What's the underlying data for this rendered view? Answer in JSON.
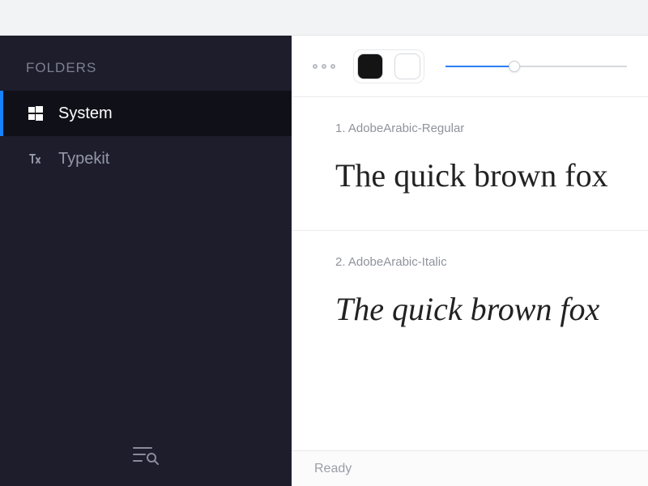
{
  "sidebar": {
    "header": "FOLDERS",
    "items": [
      {
        "label": "System",
        "icon": "windows-icon",
        "active": true
      },
      {
        "label": "Typekit",
        "icon": "typekit-icon",
        "active": false
      }
    ]
  },
  "toolbar": {
    "swatch_black": "#141414",
    "swatch_white": "#ffffff",
    "slider_percent": 38
  },
  "fonts": [
    {
      "index": "1.",
      "name": "AdobeArabic-Regular",
      "sample": "The quick brown fox",
      "style": "regular"
    },
    {
      "index": "2.",
      "name": "AdobeArabic-Italic",
      "sample": "The quick brown fox",
      "style": "italic"
    }
  ],
  "status": {
    "text": "Ready"
  }
}
